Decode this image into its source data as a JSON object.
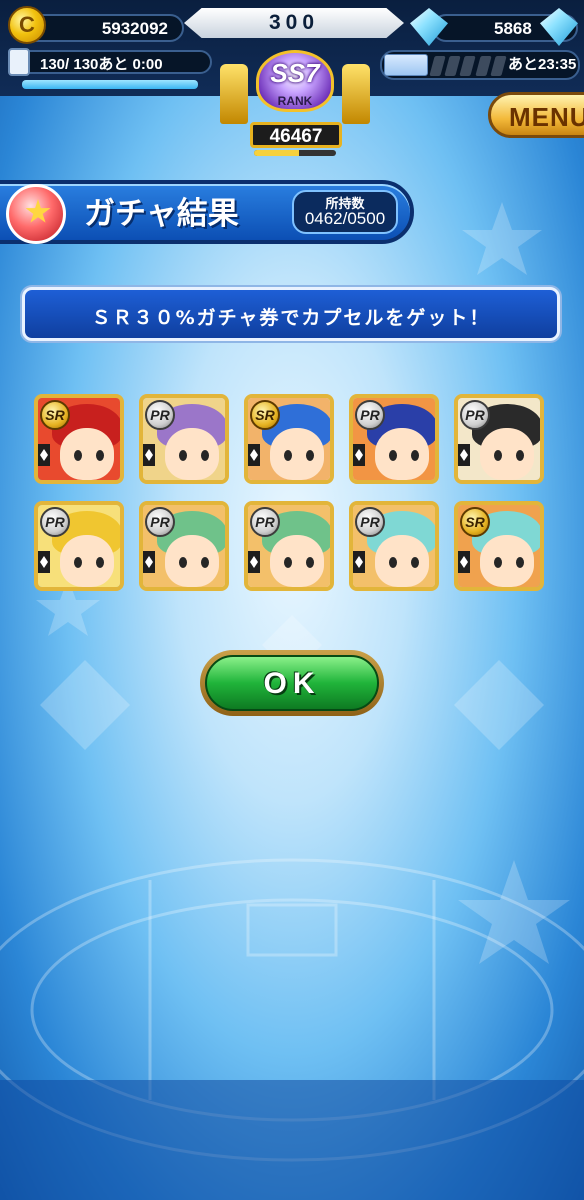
{
  "header": {
    "coins": "5932092",
    "center_value": "300",
    "gems": "5868",
    "stamina_text": "130/ 130あと  0:00",
    "stamina_fraction": 1.0,
    "ticket_timer": "あと23:35",
    "rank": {
      "title": "SS7",
      "label": "RANK",
      "score": "46467",
      "progress_fraction": 0.55
    },
    "menu_label": "MENU"
  },
  "page": {
    "title": "ガチャ結果",
    "owned_label": "所持数",
    "owned_value": "0462/0500",
    "message": "ＳＲ３０%ガチャ券でカプセルをゲット！",
    "ok_label": "OK"
  },
  "cards": [
    {
      "rarity": "SR",
      "hair": "#c8201e",
      "bg": "#e84a2e"
    },
    {
      "rarity": "PR",
      "hair": "#9b76c9",
      "bg": "#f0d48a"
    },
    {
      "rarity": "SR",
      "hair": "#2f6fd8",
      "bg": "#f2b36a"
    },
    {
      "rarity": "PR",
      "hair": "#2a3fa8",
      "bg": "#f29544"
    },
    {
      "rarity": "PR",
      "hair": "#2a2a2a",
      "bg": "#f3e7c9"
    },
    {
      "rarity": "PR",
      "hair": "#f0c630",
      "bg": "#f7e07a"
    },
    {
      "rarity": "PR",
      "hair": "#6fc28a",
      "bg": "#f3c06a"
    },
    {
      "rarity": "PR",
      "hair": "#6fc28a",
      "bg": "#f3c06a"
    },
    {
      "rarity": "PR",
      "hair": "#7fd8d4",
      "bg": "#f3c06a"
    },
    {
      "rarity": "SR",
      "hair": "#7fd8d4",
      "bg": "#f0a24e"
    }
  ],
  "colors": {
    "banner_blue": "#0c4fb4",
    "ok_green": "#20b43a",
    "gold_frame": "#e2b53a"
  },
  "icons": [
    "coin-icon",
    "gem-icon",
    "stamina-icon",
    "ticket-icon",
    "capsule-star-icon",
    "trophy-icon"
  ]
}
